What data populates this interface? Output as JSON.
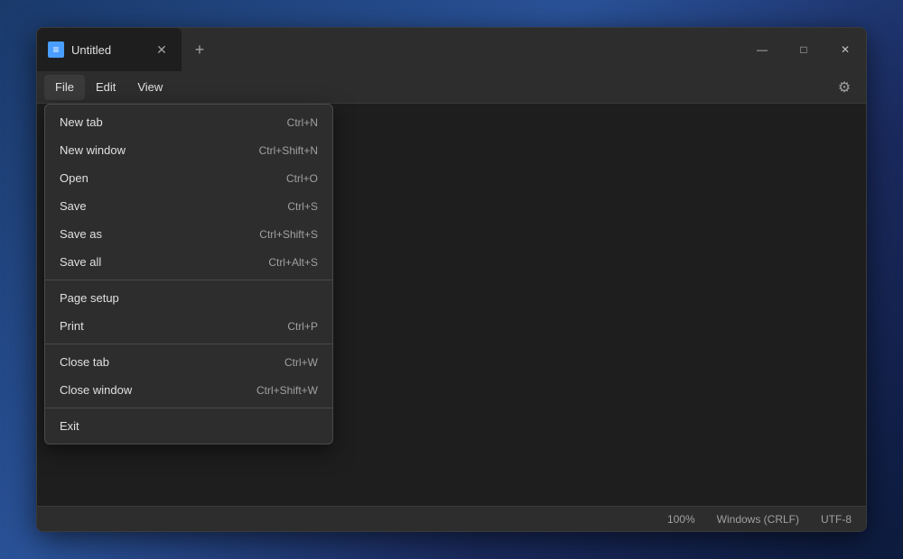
{
  "window": {
    "title": "Untitled",
    "controls": {
      "minimize": "—",
      "maximize": "□",
      "close": "✕"
    }
  },
  "titlebar": {
    "tab_title": "Untitled",
    "tab_close": "✕",
    "new_tab": "+"
  },
  "menubar": {
    "items": [
      {
        "label": "File",
        "id": "file"
      },
      {
        "label": "Edit",
        "id": "edit"
      },
      {
        "label": "View",
        "id": "view"
      }
    ],
    "settings_icon": "⚙"
  },
  "file_menu": {
    "items": [
      {
        "label": "New tab",
        "shortcut": "Ctrl+N",
        "id": "new-tab"
      },
      {
        "label": "New window",
        "shortcut": "Ctrl+Shift+N",
        "id": "new-window"
      },
      {
        "label": "Open",
        "shortcut": "Ctrl+O",
        "id": "open"
      },
      {
        "label": "Save",
        "shortcut": "Ctrl+S",
        "id": "save"
      },
      {
        "label": "Save as",
        "shortcut": "Ctrl+Shift+S",
        "id": "save-as"
      },
      {
        "label": "Save all",
        "shortcut": "Ctrl+Alt+S",
        "id": "save-all"
      },
      {
        "separator": true
      },
      {
        "label": "Page setup",
        "shortcut": "",
        "id": "page-setup"
      },
      {
        "label": "Print",
        "shortcut": "Ctrl+P",
        "id": "print"
      },
      {
        "separator": true
      },
      {
        "label": "Close tab",
        "shortcut": "Ctrl+W",
        "id": "close-tab"
      },
      {
        "label": "Close window",
        "shortcut": "Ctrl+Shift+W",
        "id": "close-window"
      },
      {
        "separator": true
      },
      {
        "label": "Exit",
        "shortcut": "",
        "id": "exit"
      }
    ]
  },
  "statusbar": {
    "zoom": "100%",
    "line_ending": "Windows (CRLF)",
    "encoding": "UTF-8"
  }
}
